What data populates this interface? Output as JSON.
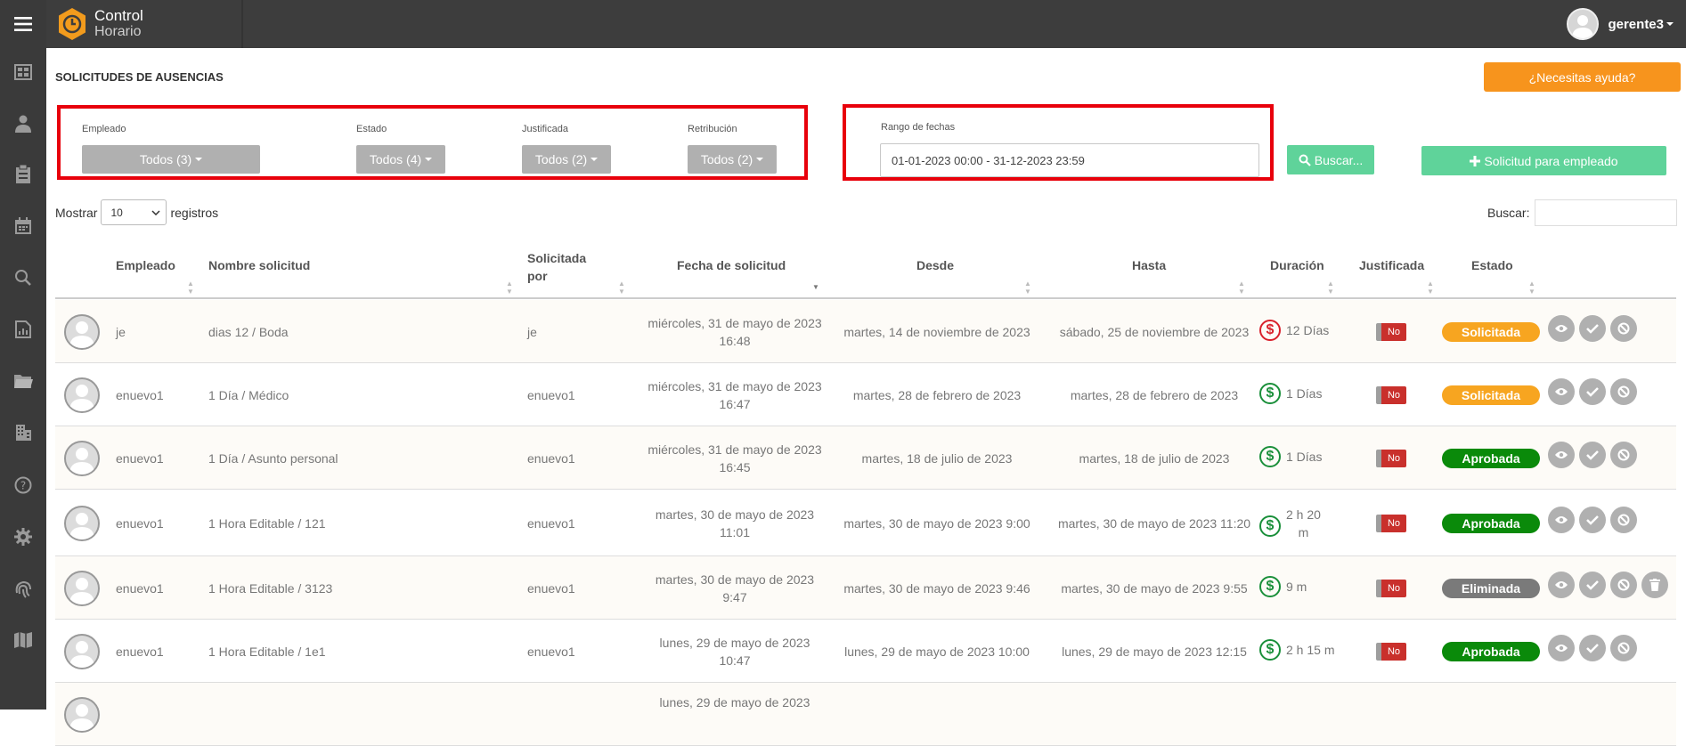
{
  "app": {
    "brand_line1": "Control",
    "brand_line2": "Horario",
    "user_name": "gerente3"
  },
  "colors": {
    "sidebar": "#3a3a3a",
    "topbar": "#3d3d3d",
    "help": "#f7941d",
    "primary_green": "#5fd39a",
    "solicitada": "#f7a520",
    "aprobada": "#0a8a0a",
    "eliminada": "#7a7a7a",
    "highlight": "#e8000b"
  },
  "sidebar": {
    "icons": [
      "dashboard-icon",
      "user-icon",
      "clipboard-icon",
      "calendar-icon",
      "search-icon",
      "report-icon",
      "folder-icon",
      "building-icon",
      "help-icon",
      "settings-icon",
      "fingerprint-icon",
      "map-icon"
    ]
  },
  "page": {
    "title": "SOLICITUDES DE AUSENCIAS",
    "help_label": "¿Necesitas ayuda?"
  },
  "filters": {
    "empleado_label": "Empleado",
    "empleado_value": "Todos (3)",
    "estado_label": "Estado",
    "estado_value": "Todos (4)",
    "justificada_label": "Justificada",
    "justificada_value": "Todos (2)",
    "retribucion_label": "Retribución",
    "retribucion_value": "Todos (2)",
    "rango_label": "Rango de fechas",
    "rango_value": "01-01-2023 00:00 - 31-12-2023 23:59",
    "buscar_label": "Buscar...",
    "new_label": "Solicitud para empleado"
  },
  "table_controls": {
    "show_label": "Mostrar",
    "show_value": "10",
    "records_label": "registros",
    "search_label": "Buscar:"
  },
  "columns": {
    "empleado": "Empleado",
    "nombre": "Nombre solicitud",
    "solicitada_1": "Solicitada",
    "solicitada_2": "por",
    "fecha": "Fecha de solicitud",
    "desde": "Desde",
    "hasta": "Hasta",
    "duracion": "Duración",
    "justificada": "Justificada",
    "estado": "Estado"
  },
  "rows": [
    {
      "empleado": "je",
      "nombre": "dias 12 / Boda",
      "solicitada_por": "je",
      "fecha_1": "miércoles, 31 de mayo de 2023",
      "fecha_2": "16:48",
      "desde": "martes, 14 de noviembre de 2023",
      "hasta": "sábado, 25 de noviembre de 2023",
      "duracion_1": "12 Días",
      "duracion_2": "",
      "justificada": "No",
      "estado": "Solicitada"
    },
    {
      "empleado": "enuevo1",
      "nombre": "1 Día / Médico",
      "solicitada_por": "enuevo1",
      "fecha_1": "miércoles, 31 de mayo de 2023",
      "fecha_2": "16:47",
      "desde": "martes, 28 de febrero de 2023",
      "hasta": "martes, 28 de febrero de 2023",
      "duracion_1": "1 Días",
      "duracion_2": "",
      "justificada": "No",
      "estado": "Solicitada"
    },
    {
      "empleado": "enuevo1",
      "nombre": "1 Día / Asunto personal",
      "solicitada_por": "enuevo1",
      "fecha_1": "miércoles, 31 de mayo de 2023",
      "fecha_2": "16:45",
      "desde": "martes, 18 de julio de 2023",
      "hasta": "martes, 18 de julio de 2023",
      "duracion_1": "1 Días",
      "duracion_2": "",
      "justificada": "No",
      "estado": "Aprobada"
    },
    {
      "empleado": "enuevo1",
      "nombre": "1 Hora Editable / 121",
      "solicitada_por": "enuevo1",
      "fecha_1": "martes, 30 de mayo de 2023",
      "fecha_2": "11:01",
      "desde": "martes, 30 de mayo de 2023 9:00",
      "hasta": "martes, 30 de mayo de 2023 11:20",
      "duracion_1": "2 h 20",
      "duracion_2": "m",
      "justificada": "No",
      "estado": "Aprobada"
    },
    {
      "empleado": "enuevo1",
      "nombre": "1 Hora Editable / 3123",
      "solicitada_por": "enuevo1",
      "fecha_1": "martes, 30 de mayo de 2023",
      "fecha_2": "9:47",
      "desde": "martes, 30 de mayo de 2023 9:46",
      "hasta": "martes, 30 de mayo de 2023 9:55",
      "duracion_1": "9 m",
      "duracion_2": "",
      "justificada": "No",
      "estado": "Eliminada"
    },
    {
      "empleado": "enuevo1",
      "nombre": "1 Hora Editable / 1e1",
      "solicitada_por": "enuevo1",
      "fecha_1": "lunes, 29 de mayo de 2023",
      "fecha_2": "10:47",
      "desde": "lunes, 29 de mayo de 2023 10:00",
      "hasta": "lunes, 29 de mayo de 2023 12:15",
      "duracion_1": "2 h 15 m",
      "duracion_2": "",
      "justificada": "No",
      "estado": "Aprobada"
    },
    {
      "empleado": "",
      "nombre": "",
      "solicitada_por": "",
      "fecha_1": "lunes, 29 de mayo de 2023",
      "fecha_2": "",
      "desde": "",
      "hasta": "",
      "duracion_1": "",
      "duracion_2": "",
      "justificada": "",
      "estado": ""
    }
  ]
}
